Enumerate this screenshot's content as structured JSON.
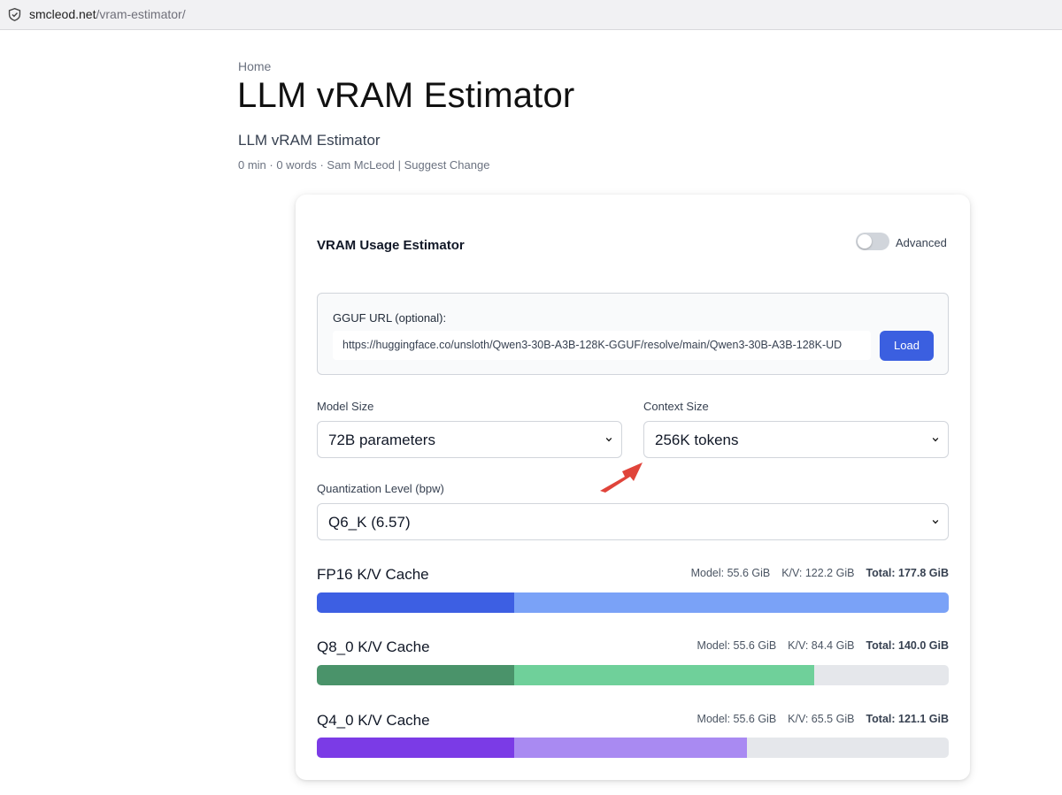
{
  "browser": {
    "domain": "smcleod.net",
    "path": "/vram-estimator/",
    "icon": "shield-icon"
  },
  "page": {
    "breadcrumb": "Home",
    "title": "LLM vRAM Estimator",
    "subtitle": "LLM vRAM Estimator",
    "meta": "0 min · 0 words · Sam McLeod | Suggest Change"
  },
  "card": {
    "title": "VRAM Usage Estimator",
    "advanced_label": "Advanced",
    "advanced_on": false,
    "gguf": {
      "label": "GGUF URL (optional):",
      "value": "https://huggingface.co/unsloth/Qwen3-30B-A3B-128K-GGUF/resolve/main/Qwen3-30B-A3B-128K-UD",
      "button": "Load"
    },
    "model_size": {
      "label": "Model Size",
      "value": "72B parameters"
    },
    "context_size": {
      "label": "Context Size",
      "value": "256K tokens"
    },
    "quantization": {
      "label": "Quantization Level (bpw)",
      "value": "Q6_K (6.57)"
    },
    "caches": [
      {
        "title": "FP16 K/V Cache",
        "model": "Model: 55.6 GiB",
        "kv": "K/V: 122.2 GiB",
        "total": "Total: 177.8 GiB",
        "model_gib": 55.6,
        "kv_gib": 122.2,
        "total_gib": 177.8,
        "model_color": "#3d5fe3",
        "kv_color": "#7aa2f7",
        "fill_fraction": 1.0
      },
      {
        "title": "Q8_0 K/V Cache",
        "model": "Model: 55.6 GiB",
        "kv": "K/V: 84.4 GiB",
        "total": "Total: 140.0 GiB",
        "model_gib": 55.6,
        "kv_gib": 84.4,
        "total_gib": 140.0,
        "model_color": "#4a936a",
        "kv_color": "#6fd09a",
        "fill_fraction": 0.787
      },
      {
        "title": "Q4_0 K/V Cache",
        "model": "Model: 55.6 GiB",
        "kv": "K/V: 65.5 GiB",
        "total": "Total: 121.1 GiB",
        "model_gib": 55.6,
        "kv_gib": 65.5,
        "total_gib": 121.1,
        "model_color": "#7b3be6",
        "kv_color": "#a98af2",
        "fill_fraction": 0.681
      }
    ]
  },
  "annotation": {
    "arrow_color": "#e0443a"
  }
}
